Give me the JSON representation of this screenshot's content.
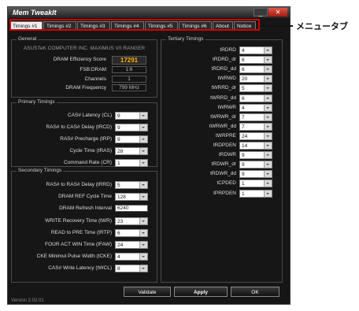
{
  "window": {
    "title": "Mem TweakIt",
    "version": "Version 2.02.01"
  },
  "tabs": [
    "Timings #1",
    "Timings #2",
    "Timings #3",
    "Timings #4",
    "Timings #5",
    "Timings #6",
    "About",
    "Notice"
  ],
  "callout": "メニュータブ",
  "general": {
    "title": "General",
    "board": "ASUSTeK COMPUTER INC. MAXIMUS VII RANGER",
    "rows": [
      {
        "label": "DRAM Efficiency Score",
        "value": "17291"
      },
      {
        "label": "FSB:DRAM",
        "value": "1:6"
      },
      {
        "label": "Channels",
        "value": "1"
      },
      {
        "label": "DRAM Frequency",
        "value": "799 MHz"
      }
    ]
  },
  "primary": {
    "title": "Primary Timings",
    "rows": [
      {
        "label": "CAS# Latency (CL)",
        "value": "9"
      },
      {
        "label": "RAS# to CAS# Delay (tRCD)",
        "value": "9"
      },
      {
        "label": "RAS# Precharge (tRP)",
        "value": "9"
      },
      {
        "label": "Cycle Time (tRAS)",
        "value": "28"
      },
      {
        "label": "Command Rate (CR)",
        "value": "1"
      }
    ]
  },
  "secondary": {
    "title": "Secondary Timings",
    "rows": [
      {
        "label": "RAS# to RAS# Delay (tRRD)",
        "value": "5",
        "kind": "combo"
      },
      {
        "label": "DRAM REF Cycle Time",
        "value": "128",
        "kind": "combo"
      },
      {
        "label": "DRAM Refresh Interval",
        "value": "6240",
        "kind": "text"
      },
      {
        "label": "WRITE Recovery Time (tWR)",
        "value": "23",
        "kind": "combo"
      },
      {
        "label": "READ to PRE Time (tRTP)",
        "value": "6",
        "kind": "combo"
      },
      {
        "label": "FOUR ACT WIN Time (tFAW)",
        "value": "24",
        "kind": "combo"
      },
      {
        "label": "CKE Minimul Pulse Width (tCKE)",
        "value": "4",
        "kind": "combo"
      },
      {
        "label": "CAS# Write Latency (tWCL)",
        "value": "8",
        "kind": "combo"
      }
    ]
  },
  "tertiary": {
    "title": "Tertiary Timings",
    "rows": [
      {
        "label": "tRDRD",
        "value": "4"
      },
      {
        "label": "tRDRD_dr",
        "value": "6"
      },
      {
        "label": "tRDRD_dd",
        "value": "6"
      },
      {
        "label": "tWRWD",
        "value": "20"
      },
      {
        "label": "tWRRD_dr",
        "value": "5"
      },
      {
        "label": "tWRRD_dd",
        "value": "6"
      },
      {
        "label": "tWRWR",
        "value": "4"
      },
      {
        "label": "tWRWR_dr",
        "value": "7"
      },
      {
        "label": "tWRWR_dd",
        "value": "7"
      },
      {
        "label": "tWRPRE",
        "value": "24"
      },
      {
        "label": "tRDPDEN",
        "value": "14"
      },
      {
        "label": "tRDWR",
        "value": "9"
      },
      {
        "label": "tRDWR_dr",
        "value": "9"
      },
      {
        "label": "tRDWR_dd",
        "value": "9"
      },
      {
        "label": "tCPDED",
        "value": "1"
      },
      {
        "label": "tPRPDEN",
        "value": "1"
      }
    ]
  },
  "buttons": {
    "validate": "Validate",
    "apply": "Apply",
    "ok": "OK"
  }
}
